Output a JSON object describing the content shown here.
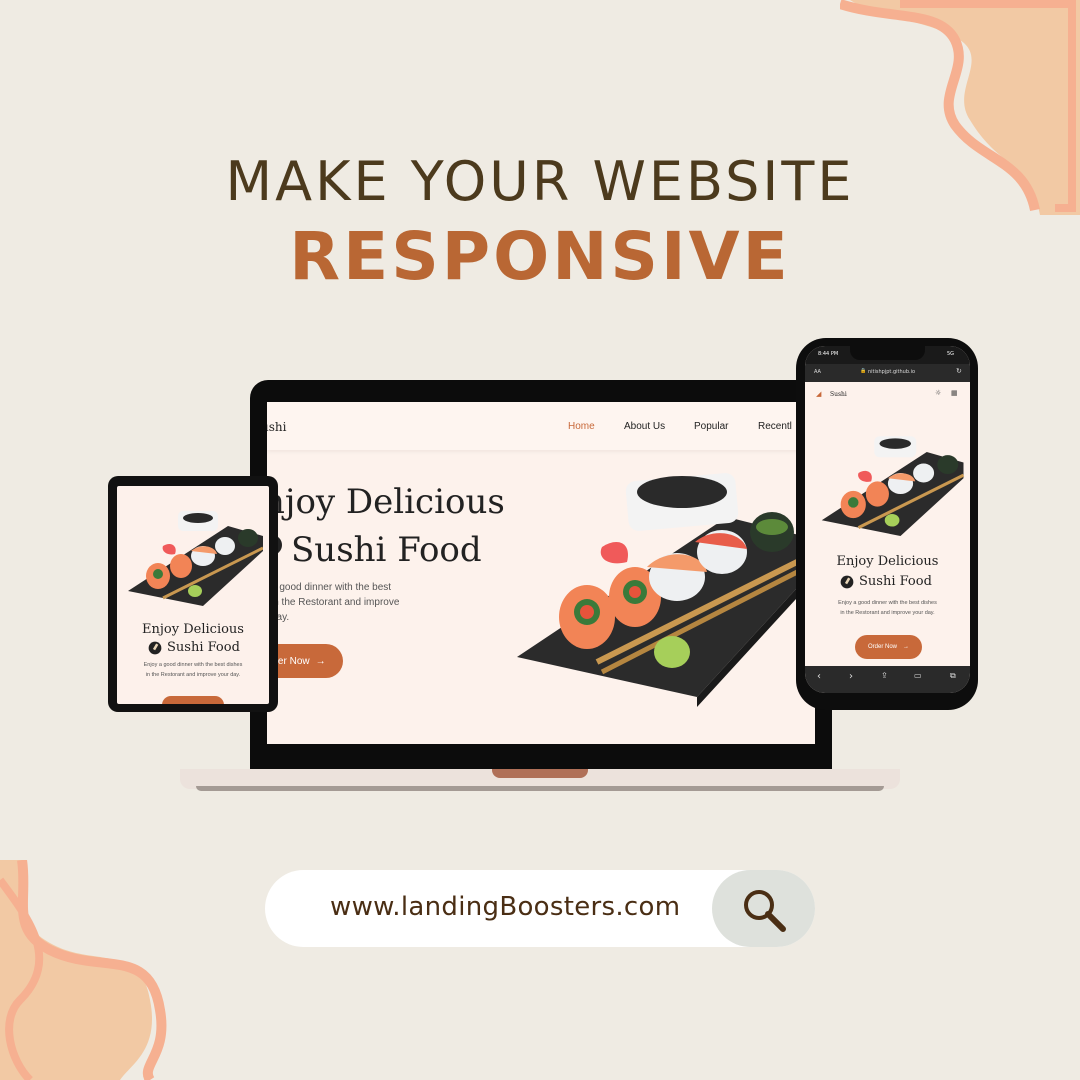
{
  "headline": {
    "line1": "MAKE YOUR WEBSITE",
    "line2": "RESPONSIVE"
  },
  "laptop": {
    "logo": "ushi",
    "nav": [
      "Home",
      "About Us",
      "Popular",
      "Recentl"
    ],
    "title_line1": "njoy Delicious",
    "title_line2": "Sushi Food",
    "desc_line1": "a good dinner with the best",
    "desc_line2": "in the Restorant and improve",
    "desc_line3": "day.",
    "order_label": "der Now"
  },
  "tablet": {
    "title_line1": "Enjoy Delicious",
    "title_line2": "Sushi Food",
    "desc_line1": "Enjoy a good dinner with the best dishes",
    "desc_line2": "in the Restorant and improve your day."
  },
  "phone": {
    "time": "8:44 PM",
    "signal": "5G",
    "aa": "AA",
    "url": "nitishpjpt.github.io",
    "logo": "Sushi",
    "title_line1": "Enjoy Delicious",
    "title_line2": "Sushi Food",
    "desc_line1": "Enjoy a good dinner with the best dishes",
    "desc_line2": "in the Restorant and improve your day.",
    "order_label": "Order Now"
  },
  "search": {
    "url": "www.landingBoosters.com"
  },
  "colors": {
    "background": "#efebe3",
    "accent": "#c8693a",
    "headline": "#4c3a1d",
    "headline_accent": "#b96734"
  }
}
